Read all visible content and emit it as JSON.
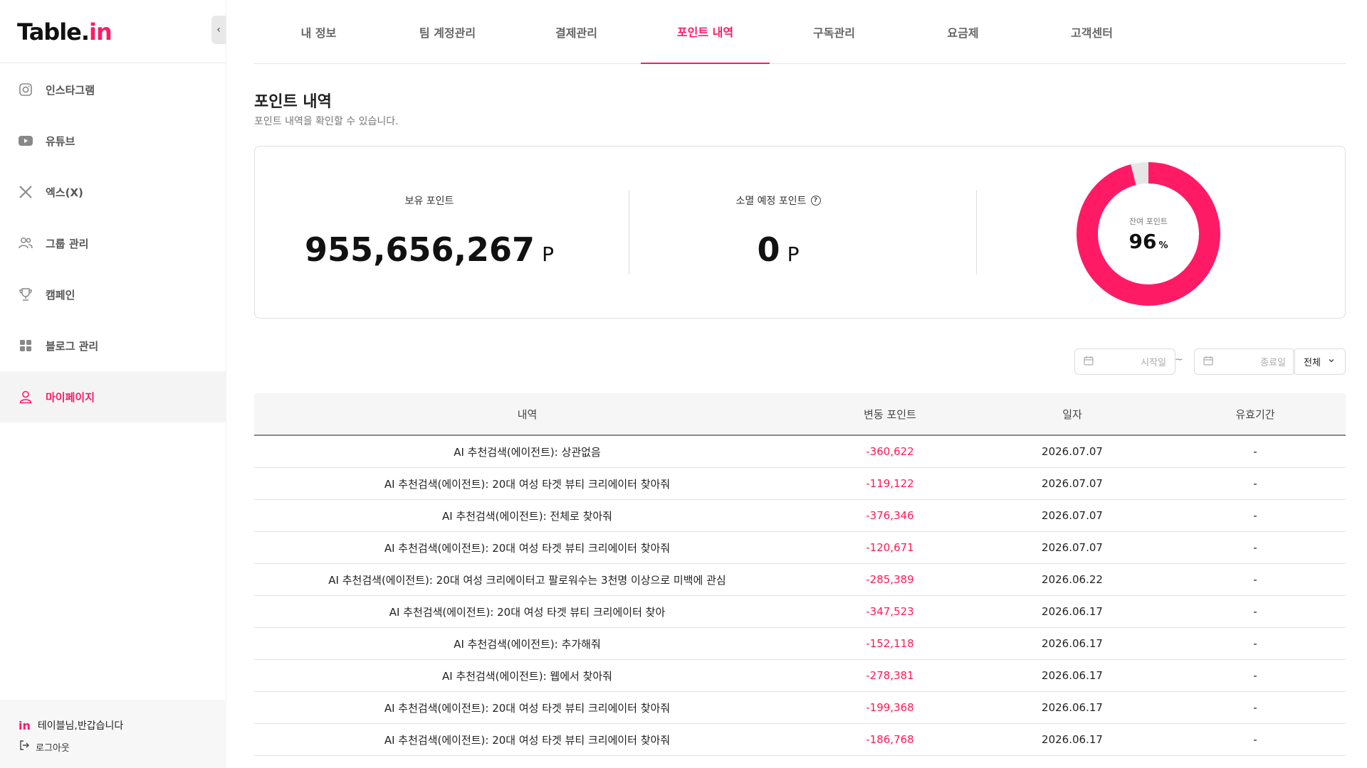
{
  "brand": {
    "logo_main": "Table.",
    "logo_accent": "in",
    "accent_color": "#ff1a66"
  },
  "sidebar": {
    "items": [
      {
        "label": "인스타그램",
        "icon": "instagram-icon"
      },
      {
        "label": "유튜브",
        "icon": "youtube-icon"
      },
      {
        "label": "엑스(X)",
        "icon": "x-icon"
      },
      {
        "label": "그룹 관리",
        "icon": "group-icon"
      },
      {
        "label": "캠페인",
        "icon": "trophy-icon"
      },
      {
        "label": "블로그 관리",
        "icon": "grid-icon"
      },
      {
        "label": "마이페이지",
        "icon": "user-icon",
        "active": true
      }
    ],
    "footer": {
      "greeting": "테이블님,반갑습니다",
      "logout": "로그아웃",
      "brand_mark": "in"
    }
  },
  "tabs": [
    "내 정보",
    "팀 계정관리",
    "결제관리",
    "포인트 내역",
    "구독관리",
    "요금제",
    "고객센터"
  ],
  "active_tab": 3,
  "page": {
    "title": "포인트 내역",
    "subtitle": "포인트 내역을 확인할 수 있습니다."
  },
  "summary": {
    "owned_label": "보유 포인트",
    "owned_value": "955,656,267",
    "owned_unit": "P",
    "expiring_label": "소멸 예정 포인트",
    "expiring_value": "0",
    "expiring_unit": "P",
    "remaining_label": "잔여 포인트",
    "remaining_value": "96",
    "remaining_unit": "%",
    "remaining_fraction": 0.96
  },
  "filters": {
    "start_placeholder": "시작일",
    "end_placeholder": "종료일",
    "separator": "~",
    "select_value": "전체"
  },
  "table": {
    "headers": [
      "내역",
      "변동 포인트",
      "일자",
      "유효기간"
    ],
    "rows": [
      [
        "AI 추천검색(에이전트): 상관없음",
        "-360,622",
        "2026.07.07",
        "-"
      ],
      [
        "AI 추천검색(에이전트): 20대 여성 타겟 뷰티 크리에이터 찾아줘",
        "-119,122",
        "2026.07.07",
        "-"
      ],
      [
        "AI 추천검색(에이전트): 전체로 찾아줘",
        "-376,346",
        "2026.07.07",
        "-"
      ],
      [
        "AI 추천검색(에이전트): 20대 여성 타겟 뷰티 크리에이터 찾아줘",
        "-120,671",
        "2026.07.07",
        "-"
      ],
      [
        "AI 추천검색(에이전트): 20대 여성 크리에이터고 팔로워수는 3천명 이상으로 미백에 관심",
        "-285,389",
        "2026.06.22",
        "-"
      ],
      [
        "AI 추천검색(에이전트): 20대 여성 타겟 뷰티 크리에이터 찾아",
        "-347,523",
        "2026.06.17",
        "-"
      ],
      [
        "AI 추천검색(에이전트): 추가해줘",
        "-152,118",
        "2026.06.17",
        "-"
      ],
      [
        "AI 추천검색(에이전트): 웹에서 찾아줘",
        "-278,381",
        "2026.06.17",
        "-"
      ],
      [
        "AI 추천검색(에이전트): 20대 여성 타겟 뷰티 크리에이터 찾아줘",
        "-199,368",
        "2026.06.17",
        "-"
      ],
      [
        "AI 추천검색(에이전트): 20대 여성 타겟 뷰티 크리에이터 찾아줘",
        "-186,768",
        "2026.06.17",
        "-"
      ]
    ]
  }
}
